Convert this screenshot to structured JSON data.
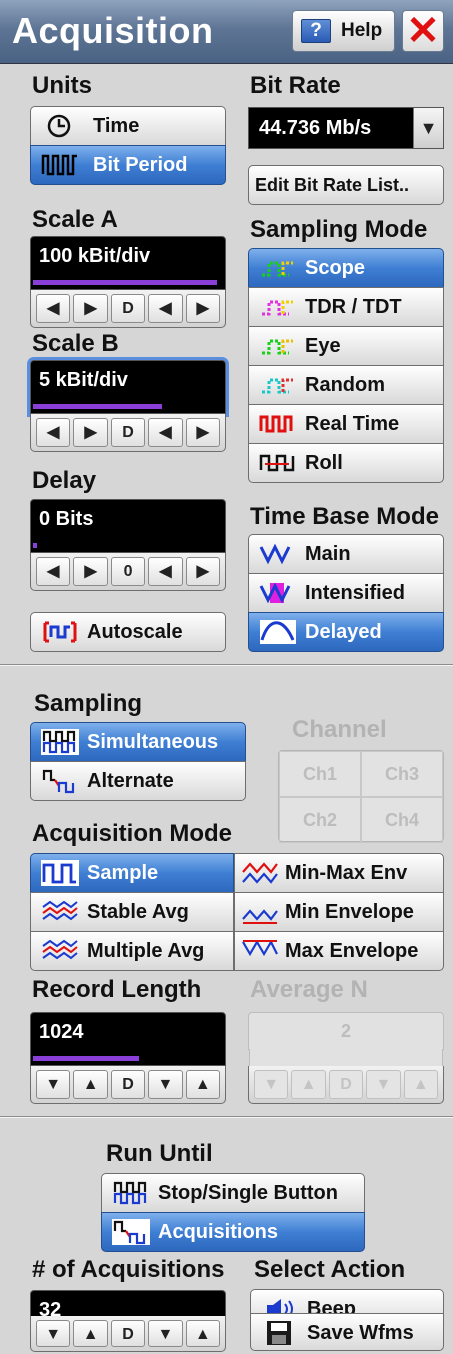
{
  "title": "Acquisition",
  "help_label": "Help",
  "help_icon": "?",
  "close_icon": "✕",
  "units": {
    "label": "Units",
    "options": [
      {
        "label": "Time",
        "icon": "clock-icon",
        "selected": false
      },
      {
        "label": "Bit Period",
        "icon": "bit-period-icon",
        "selected": true
      }
    ]
  },
  "bit_rate": {
    "label": "Bit Rate",
    "value": "44.736 Mb/s",
    "edit_label": "Edit Bit Rate List.."
  },
  "scale_a": {
    "label": "Scale A",
    "value": "100 kBit/div",
    "bar_fraction": 0.97
  },
  "scale_b": {
    "label": "Scale B",
    "value": "5 kBit/div",
    "bar_fraction": 0.68
  },
  "delay": {
    "label": "Delay",
    "value": "0 Bits",
    "bar_fraction": 0.02
  },
  "spinner": {
    "left": "◀",
    "right": "▶",
    "reset": "D",
    "zero": "0",
    "down": "▼",
    "up": "▲"
  },
  "sampling_mode": {
    "label": "Sampling Mode",
    "options": [
      {
        "label": "Scope",
        "selected": true
      },
      {
        "label": "TDR / TDT",
        "selected": false
      },
      {
        "label": "Eye",
        "selected": false
      },
      {
        "label": "Random",
        "selected": false
      },
      {
        "label": "Real Time",
        "selected": false
      },
      {
        "label": "Roll",
        "selected": false
      }
    ]
  },
  "time_base_mode": {
    "label": "Time Base Mode",
    "options": [
      {
        "label": "Main",
        "selected": false
      },
      {
        "label": "Intensified",
        "selected": false
      },
      {
        "label": "Delayed",
        "selected": true
      }
    ]
  },
  "autoscale_label": "Autoscale",
  "sampling": {
    "label": "Sampling",
    "options": [
      {
        "label": "Simultaneous",
        "selected": true
      },
      {
        "label": "Alternate",
        "selected": false
      }
    ]
  },
  "channel": {
    "label": "Channel",
    "items": [
      "Ch1",
      "Ch3",
      "Ch2",
      "Ch4"
    ]
  },
  "acquisition_mode": {
    "label": "Acquisition Mode",
    "left": [
      {
        "label": "Sample",
        "selected": true
      },
      {
        "label": "Stable Avg",
        "selected": false
      },
      {
        "label": "Multiple Avg",
        "selected": false
      }
    ],
    "right": [
      {
        "label": "Min-Max Env",
        "selected": false
      },
      {
        "label": "Min Envelope",
        "selected": false
      },
      {
        "label": "Max Envelope",
        "selected": false
      }
    ]
  },
  "record_length": {
    "label": "Record Length",
    "value": "1024",
    "bar_fraction": 0.56
  },
  "average_n": {
    "label": "Average N",
    "value": "2"
  },
  "run_until": {
    "label": "Run Until",
    "options": [
      {
        "label": "Stop/Single Button",
        "selected": false
      },
      {
        "label": "Acquisitions",
        "selected": true
      }
    ]
  },
  "num_acquisitions": {
    "label": "# of Acquisitions",
    "value": "32",
    "bar_fraction": 0.3
  },
  "select_action": {
    "label": "Select Action",
    "options": [
      {
        "label": "Beep",
        "icon": "speaker-icon"
      },
      {
        "label": "Save Wfms",
        "icon": "floppy-disk-icon"
      }
    ]
  },
  "colors": {
    "selected": "#3f7fd3",
    "title_bar": "#5e7595",
    "bar": "#8a3fd9"
  }
}
